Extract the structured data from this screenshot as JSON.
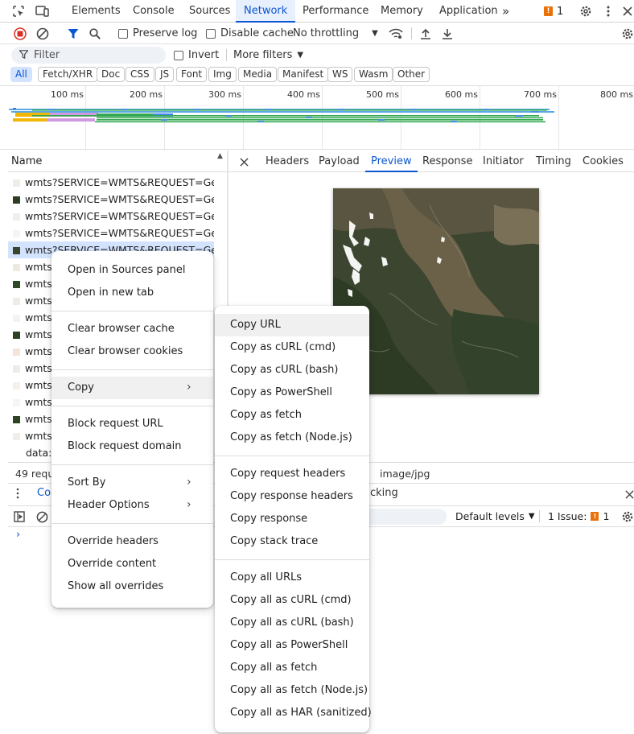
{
  "top_tabs": [
    "Elements",
    "Console",
    "Sources",
    "Network",
    "Performance",
    "Memory",
    "Application"
  ],
  "top_more": "»",
  "issue_count": "1",
  "toolbar": {
    "preserve_log": "Preserve log",
    "disable_cache": "Disable cache",
    "throttling": "No throttling"
  },
  "filter": {
    "placeholder": "Filter",
    "invert": "Invert",
    "more_filters": "More filters"
  },
  "type_filters": [
    "All",
    "Fetch/XHR",
    "Doc",
    "CSS",
    "JS",
    "Font",
    "Img",
    "Media",
    "Manifest",
    "WS",
    "Wasm",
    "Other"
  ],
  "timeline_ticks": [
    "100 ms",
    "200 ms",
    "300 ms",
    "400 ms",
    "500 ms",
    "600 ms",
    "700 ms",
    "800 ms"
  ],
  "list": {
    "header": "Name",
    "rows": [
      "wmts?SERVICE=WMTS&REQUEST=Ge...",
      "wmts?SERVICE=WMTS&REQUEST=Ge...",
      "wmts?SERVICE=WMTS&REQUEST=Ge...",
      "wmts?SERVICE=WMTS&REQUEST=Ge...",
      "wmts?SERVICE=WMTS&REQUEST=Ge...",
      "wmts",
      "wmts",
      "wmts",
      "wmts",
      "wmts",
      "wmts",
      "wmts",
      "wmts",
      "wmts",
      "wmts",
      "wmts",
      "data:i"
    ],
    "status": "49 requ",
    "mime": "image/jpg"
  },
  "detail_tabs": [
    "Headers",
    "Payload",
    "Preview",
    "Response",
    "Initiator",
    "Timing",
    "Cookies"
  ],
  "drawer": {
    "tab": "Co",
    "tab2": "cking",
    "levels": "Default levels",
    "issues_label": "1 Issue:",
    "issues_count": "1"
  },
  "context_menu": {
    "items_1": [
      "Open in Sources panel",
      "Open in new tab"
    ],
    "items_2": [
      "Clear browser cache",
      "Clear browser cookies"
    ],
    "copy": "Copy",
    "items_4": [
      "Block request URL",
      "Block request domain"
    ],
    "sort_by": "Sort By",
    "header_options": "Header Options",
    "items_6": [
      "Override headers",
      "Override content",
      "Show all overrides"
    ]
  },
  "copy_submenu": {
    "group_1": [
      "Copy URL",
      "Copy as cURL (cmd)",
      "Copy as cURL (bash)",
      "Copy as PowerShell",
      "Copy as fetch",
      "Copy as fetch (Node.js)"
    ],
    "group_2": [
      "Copy request headers",
      "Copy response headers",
      "Copy response",
      "Copy stack trace"
    ],
    "group_3": [
      "Copy all URLs",
      "Copy all as cURL (cmd)",
      "Copy all as cURL (bash)",
      "Copy all as PowerShell",
      "Copy all as fetch",
      "Copy all as fetch (Node.js)",
      "Copy all as HAR (sanitized)"
    ]
  },
  "colors": {
    "accent": "#0b57d0",
    "record_red": "#d93025",
    "issue_orange": "#e8710a"
  }
}
